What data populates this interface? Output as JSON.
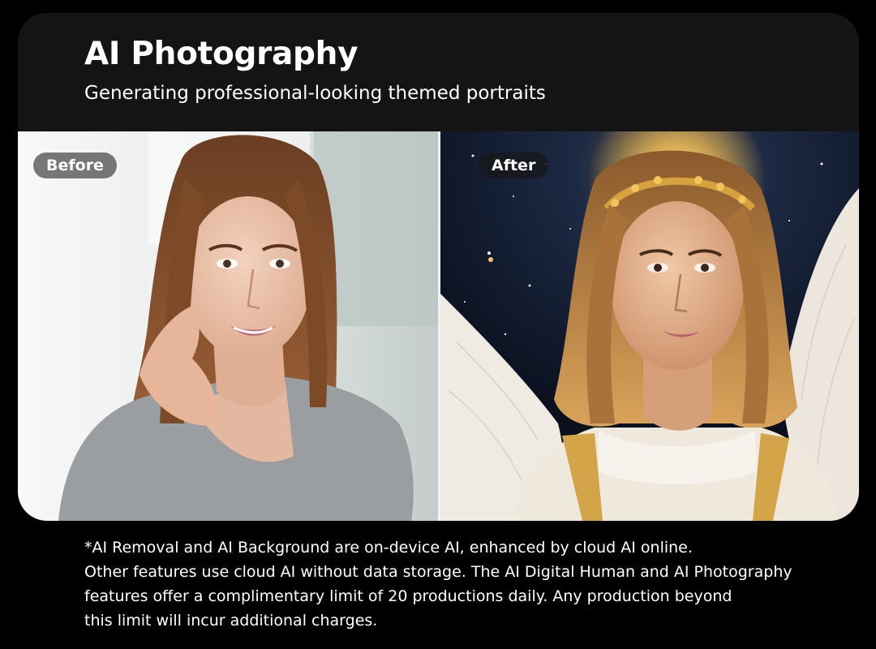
{
  "header": {
    "title": "AI Photography",
    "subtitle": "Generating professional-looking themed portraits"
  },
  "comparison": {
    "before_label": "Before",
    "after_label": "After"
  },
  "footnote": {
    "lines": [
      "*AI Removal and AI Background are on-device AI, enhanced by cloud AI online.",
      "Other features use cloud AI without data storage. The AI Digital Human and AI Photography",
      "features offer a complimentary limit of 20 productions daily. Any production beyond",
      "this limit will incur additional charges."
    ]
  },
  "colors": {
    "page_background": "#000000",
    "card_background": "#141414",
    "text": "#ffffff"
  }
}
